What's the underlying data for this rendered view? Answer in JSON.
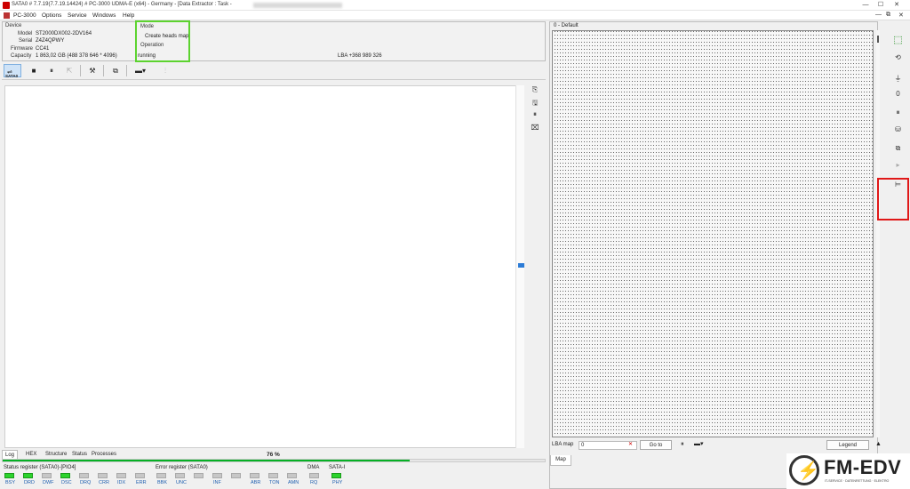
{
  "window": {
    "title": "SATA0 # 7.7.19(7.7.19.14424) # PC-3000 UDMA-E (x64) - Germany - [Data Extractor : Task -",
    "controls": [
      "—",
      "☐",
      "✕"
    ]
  },
  "menu": {
    "items": [
      "PC-3000",
      "Options",
      "Service",
      "Windows",
      "Help"
    ],
    "mdi_controls": [
      "—",
      "⧉",
      "✕"
    ]
  },
  "device": {
    "header": "Device",
    "model_label": "Model",
    "model": "ST2000DX002-2DV164",
    "serial_label": "Serial",
    "serial": "Z4Z4QPWY",
    "firmware_label": "Firmware",
    "firmware": "CC41",
    "capacity_label": "Capacity",
    "capacity": "1 863,02 GB (488 378 646 * 4096)",
    "mode_label": "Mode",
    "mode": "Create heads map",
    "operation_label": "Operation",
    "operation": "running",
    "lba": "LBA +368 989 326"
  },
  "toolbar": {
    "port_label": "SATA0"
  },
  "bottom_tabs": [
    "Log",
    "HEX",
    "Structure",
    "Status",
    "Processes"
  ],
  "progress": {
    "percent_text": "76 %",
    "value": 0.75
  },
  "registers": {
    "status_title": "Status register (SATA0)-[PIO4]",
    "error_title": "Error register (SATA0)",
    "dma_title": "DMA",
    "sata_title": "SATA-I",
    "status_bits": [
      {
        "name": "BSY",
        "on": true
      },
      {
        "name": "DRD",
        "on": true
      },
      {
        "name": "DWF",
        "on": false
      },
      {
        "name": "DSC",
        "on": true
      },
      {
        "name": "DRQ",
        "on": false
      },
      {
        "name": "CRR",
        "on": false
      },
      {
        "name": "IDX",
        "on": false
      },
      {
        "name": "ERR",
        "on": false
      }
    ],
    "error_bits": [
      {
        "name": "BBK",
        "on": false
      },
      {
        "name": "UNC",
        "on": false
      },
      {
        "name": "",
        "on": false
      },
      {
        "name": "INF",
        "on": false
      },
      {
        "name": "",
        "on": false
      },
      {
        "name": "ABR",
        "on": false
      },
      {
        "name": "TON",
        "on": false
      },
      {
        "name": "AMN",
        "on": false
      }
    ],
    "dma_bits": [
      {
        "name": "RQ",
        "on": false
      }
    ],
    "sata_bits": [
      {
        "name": "PHY",
        "on": true
      }
    ]
  },
  "map": {
    "title": "0 - Default",
    "lba_map_label": "LBA map",
    "lba_input": "0",
    "goto_label": "Go to",
    "legend_label": "Legend",
    "tab_label": "Map"
  },
  "logo": {
    "name": "FM-EDV",
    "tagline": "IT-SERVICE · DATENRETTUNG · ELEKTRO"
  },
  "colors": {
    "highlight_green": "#5cd32f",
    "highlight_red": "#e01818",
    "progress": "#06b025",
    "led_on": "#2cd32c"
  }
}
